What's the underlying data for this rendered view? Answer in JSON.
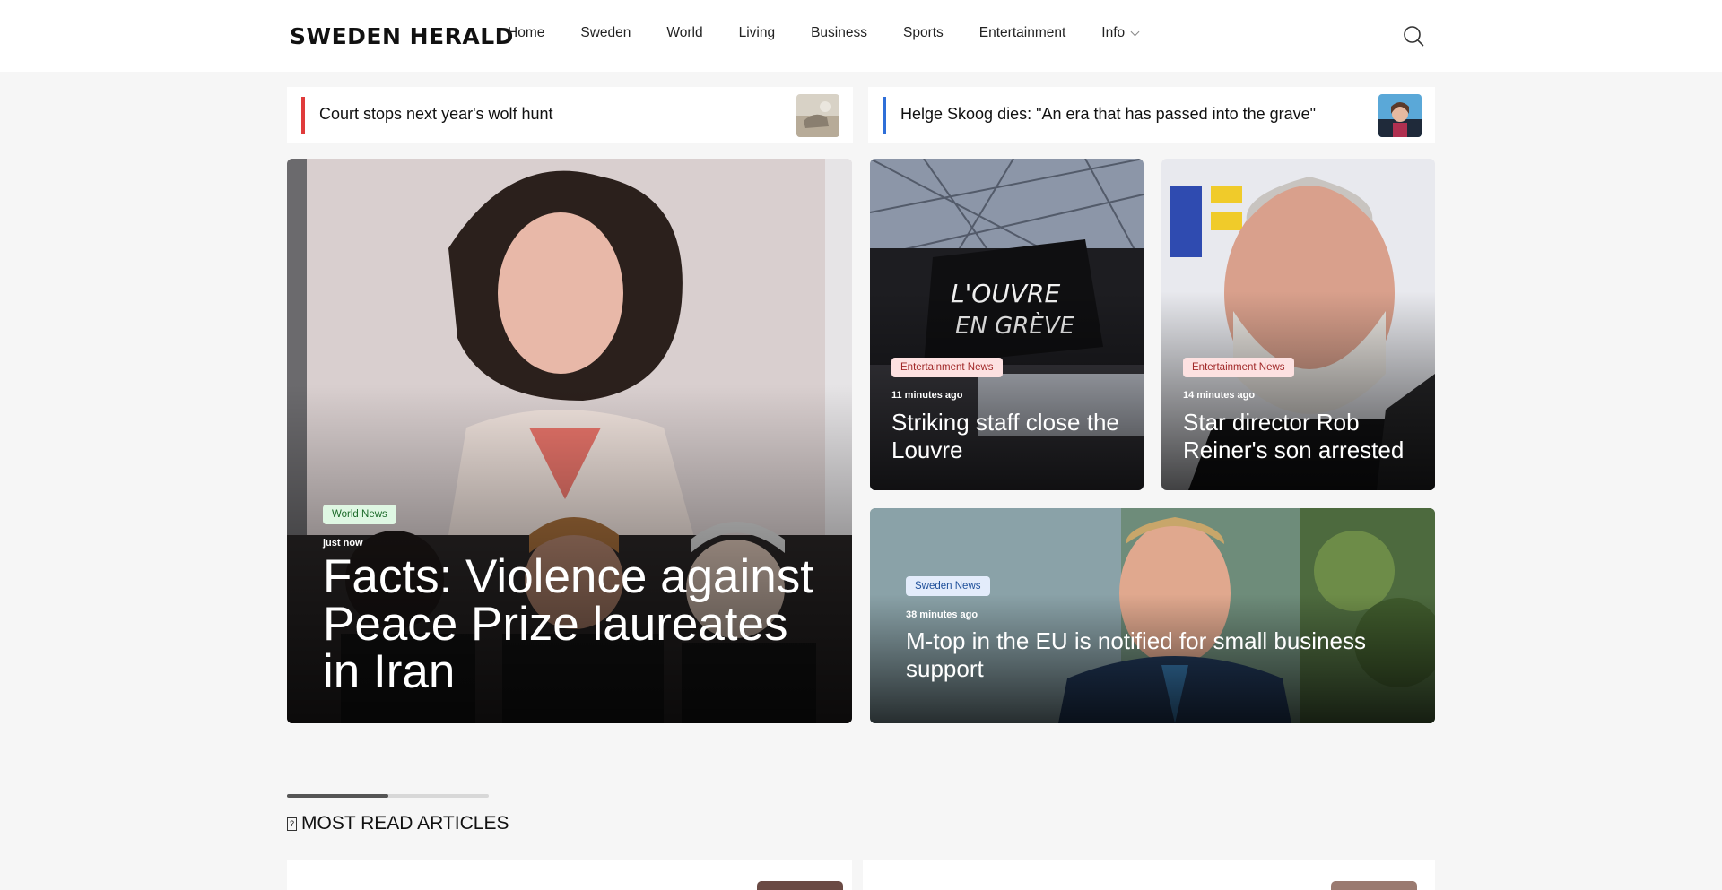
{
  "header": {
    "logo": "SWEDEN HERALD",
    "nav": [
      "Home",
      "Sweden",
      "World",
      "Living",
      "Business",
      "Sports",
      "Entertainment",
      "Info"
    ]
  },
  "teasers": [
    {
      "text": "Court stops next year's wolf hunt",
      "accent": "#e03b3b"
    },
    {
      "text": "Helge Skoog dies: \"An era that has passed into the grave\"",
      "accent": "#2f6fd8"
    }
  ],
  "main_story": {
    "category": "World News",
    "time": "just now",
    "headline": "Facts: Violence against Peace Prize laureates in Iran"
  },
  "stories": [
    {
      "category": "Entertainment News",
      "time": "11 minutes ago",
      "headline": "Striking staff close the Louvre"
    },
    {
      "category": "Entertainment News",
      "time": "14 minutes ago",
      "headline": "Star director Rob Reiner's son arrested"
    },
    {
      "category": "Sweden News",
      "time": "38 minutes ago",
      "headline": "M-top in the EU is notified for small business support"
    }
  ],
  "most_read": {
    "icon_glyph": "?",
    "title": "MOST READ ARTICLES"
  },
  "colors": {
    "world_badge": "#dff7e3",
    "entertainment_badge": "#fde1e1",
    "sweden_badge": "#e3ecfb"
  }
}
